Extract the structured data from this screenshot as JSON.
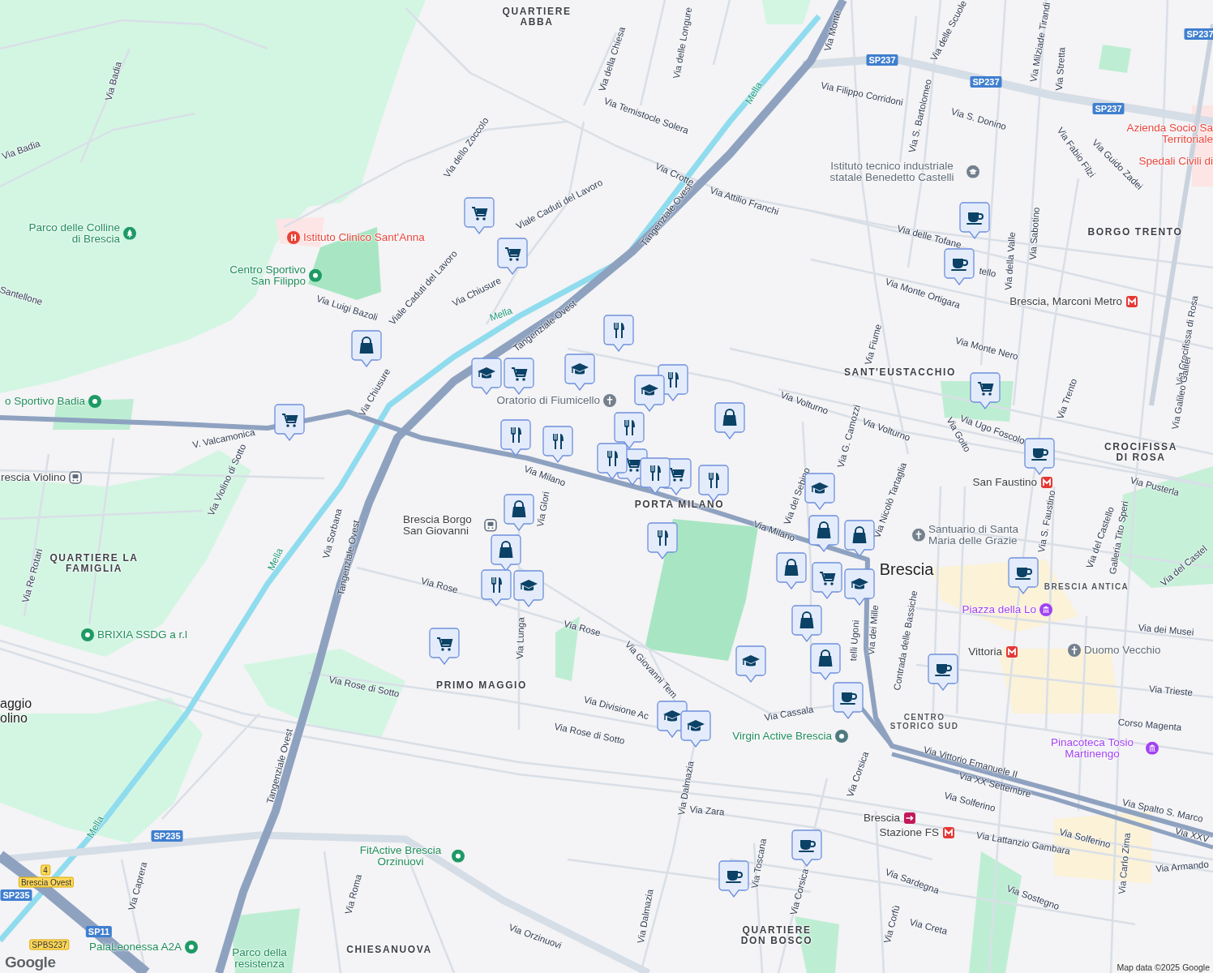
{
  "map": {
    "roads": [
      {
        "text": "Via Badia",
        "kind": "street"
      },
      {
        "text": "Via Badia",
        "kind": "street"
      },
      {
        "text": "Santellone",
        "kind": "street"
      },
      {
        "text": "Via Luigi Bazoli",
        "kind": "street"
      },
      {
        "text": "Viale Caduti del Lavoro",
        "kind": "street"
      },
      {
        "text": "Viale Caduti del Lavoro",
        "kind": "street"
      },
      {
        "text": "Via Chiusure",
        "kind": "street"
      },
      {
        "text": "Via Chiusure",
        "kind": "street"
      },
      {
        "text": "Via dello Zoccolo",
        "kind": "street"
      },
      {
        "text": "Via della Chiesa",
        "kind": "street"
      },
      {
        "text": "Via delle Longure",
        "kind": "street"
      },
      {
        "text": "Via Temistocle Solera",
        "kind": "street"
      },
      {
        "text": "Via Crotte",
        "kind": "street"
      },
      {
        "text": "Via Attilio Franchi",
        "kind": "street"
      },
      {
        "text": "Via Filippo Corridoni",
        "kind": "street"
      },
      {
        "text": "Via S. Bartolomeo",
        "kind": "street"
      },
      {
        "text": "Via delle Scuole",
        "kind": "street"
      },
      {
        "text": "Via Milziade Tirandi",
        "kind": "street"
      },
      {
        "text": "Via Stretta",
        "kind": "street"
      },
      {
        "text": "Via S. Donino",
        "kind": "street"
      },
      {
        "text": "Via Fabio Filzi",
        "kind": "street"
      },
      {
        "text": "Via Guido Zadei",
        "kind": "street"
      },
      {
        "text": "Via delle Tofane",
        "kind": "street"
      },
      {
        "text": "tello",
        "kind": "street"
      },
      {
        "text": "Via Monte Ortigara",
        "kind": "street"
      },
      {
        "text": "Via della Valle",
        "kind": "street"
      },
      {
        "text": "Via Sabotino",
        "kind": "street"
      },
      {
        "text": "Via Monte Nero",
        "kind": "street"
      },
      {
        "text": "Via Fiume",
        "kind": "street"
      },
      {
        "text": "Via Volturno",
        "kind": "street"
      },
      {
        "text": "Via Volturno",
        "kind": "street"
      },
      {
        "text": "Via Ugo Foscolo",
        "kind": "street"
      },
      {
        "text": "Via Goito",
        "kind": "street"
      },
      {
        "text": "Via Trento",
        "kind": "street"
      },
      {
        "text": "Via Crocifissa di Rosa",
        "kind": "street"
      },
      {
        "text": "Via Galileo Galilei",
        "kind": "street"
      },
      {
        "text": "Via Pusterla",
        "kind": "street"
      },
      {
        "text": "Via Nicolò Tartaglia",
        "kind": "street"
      },
      {
        "text": "Via G. Camozzi",
        "kind": "street"
      },
      {
        "text": "Via del Sebino",
        "kind": "street"
      },
      {
        "text": "Via Milano",
        "kind": "street"
      },
      {
        "text": "Via Milano",
        "kind": "street"
      },
      {
        "text": "Via S. Faustino",
        "kind": "street"
      },
      {
        "text": "Via del Castello",
        "kind": "street"
      },
      {
        "text": "Galleria Tito Speri",
        "kind": "street"
      },
      {
        "text": "Via del Castel",
        "kind": "street"
      },
      {
        "text": "Via dei Musei",
        "kind": "street"
      },
      {
        "text": "Via Trieste",
        "kind": "street"
      },
      {
        "text": "Corso Magenta",
        "kind": "street"
      },
      {
        "text": "Contrada delle Bassiche",
        "kind": "street"
      },
      {
        "text": "Via dei Mille",
        "kind": "street"
      },
      {
        "text": "telli Ugoni",
        "kind": "street"
      },
      {
        "text": "Via Cassala",
        "kind": "street"
      },
      {
        "text": "Via Giovanni Tem",
        "kind": "street"
      },
      {
        "text": "Via Divisione Ac",
        "kind": "street"
      },
      {
        "text": "Via Rose",
        "kind": "street"
      },
      {
        "text": "Via Rose",
        "kind": "street"
      },
      {
        "text": "Via Rose di Sotto",
        "kind": "street"
      },
      {
        "text": "Via Rose di Sotto",
        "kind": "street"
      },
      {
        "text": "Via Lunga",
        "kind": "street"
      },
      {
        "text": "Via Glori",
        "kind": "street"
      },
      {
        "text": "V. Valcamonica",
        "kind": "street"
      },
      {
        "text": "Via Violino di Sotto",
        "kind": "street"
      },
      {
        "text": "Via Sorbana",
        "kind": "street"
      },
      {
        "text": "Tangenziale Ovest",
        "kind": "street"
      },
      {
        "text": "Tangenziale Ovest",
        "kind": "street"
      },
      {
        "text": "Tangenziale Ovest",
        "kind": "street"
      },
      {
        "text": "Tangenziale Ovest",
        "kind": "street"
      },
      {
        "text": "Mella",
        "kind": "river"
      },
      {
        "text": "Mella",
        "kind": "river"
      },
      {
        "text": "Mella",
        "kind": "river"
      },
      {
        "text": "Mella",
        "kind": "river"
      },
      {
        "text": "Via Re Rotari",
        "kind": "street"
      },
      {
        "text": "Via Dalmazia",
        "kind": "street"
      },
      {
        "text": "Via Dalmazia",
        "kind": "street"
      },
      {
        "text": "Via Zara",
        "kind": "street"
      },
      {
        "text": "Via Toscana",
        "kind": "street"
      },
      {
        "text": "Via Corsica",
        "kind": "street"
      },
      {
        "text": "Via Corsica",
        "kind": "street"
      },
      {
        "text": "Via Solferino",
        "kind": "street"
      },
      {
        "text": "Via Solferino",
        "kind": "street"
      },
      {
        "text": "Via Vittorio Emanuele II",
        "kind": "street"
      },
      {
        "text": "Via XX Settembre",
        "kind": "street"
      },
      {
        "text": "Via Spalto S. Marco",
        "kind": "street"
      },
      {
        "text": "Via XXV",
        "kind": "street"
      },
      {
        "text": "Via Lattanzio Gambara",
        "kind": "street"
      },
      {
        "text": "Via Armando",
        "kind": "street"
      },
      {
        "text": "Via Sardegna",
        "kind": "street"
      },
      {
        "text": "Via Sostegno",
        "kind": "street"
      },
      {
        "text": "Via Corfù",
        "kind": "street"
      },
      {
        "text": "Via Creta",
        "kind": "street"
      },
      {
        "text": "Via Carlo Zima",
        "kind": "street"
      },
      {
        "text": "Via Orzinuovi",
        "kind": "street"
      },
      {
        "text": "Via Roma",
        "kind": "street"
      },
      {
        "text": "Via Caprera",
        "kind": "street"
      },
      {
        "text": "Via Monte",
        "kind": "street"
      }
    ],
    "areas": [
      {
        "text": "QUARTIERE ABBA",
        "kind": "district"
      },
      {
        "text": "BORGO TRENTO",
        "kind": "district"
      },
      {
        "text": "CROCIFISSA DI ROSA",
        "kind": "district"
      },
      {
        "text": "QUARTIERE LA FAMIGLIA",
        "kind": "district"
      },
      {
        "text": "PRIMO MAGGIO",
        "kind": "district"
      },
      {
        "text": "PORTA MILANO",
        "kind": "district"
      },
      {
        "text": "BRESCIA ANTICA",
        "kind": "quarter"
      },
      {
        "text": "CENTRO STORICO SUD",
        "kind": "quarter"
      },
      {
        "text": "QUARTIERE DON BOSCO",
        "kind": "district"
      },
      {
        "text": "CHIESANUOVA",
        "kind": "district"
      },
      {
        "text": "SANT'EUSTACCHIO",
        "kind": "district"
      },
      {
        "text": "Brescia",
        "kind": "city"
      },
      {
        "text": "aggio olino",
        "kind": "town"
      }
    ],
    "places": [
      {
        "text": "Azienda Socio Sa Territoriale",
        "kind": "hospital"
      },
      {
        "text": "Spedali Civili di",
        "kind": "hospital"
      },
      {
        "text": "Istituto tecnico industriale statale Benedetto Castelli",
        "kind": "school"
      },
      {
        "text": "Parco delle Colline di Brescia",
        "kind": "park"
      },
      {
        "text": "Istituto Clinico Sant'Anna",
        "kind": "hospital"
      },
      {
        "text": "Centro Sportivo San Filippo",
        "kind": "sport"
      },
      {
        "text": "Brescia, Marconi Metro",
        "kind": "metro"
      },
      {
        "text": "o Sportivo Badia",
        "kind": "sport"
      },
      {
        "text": "Oratorio di Fiumicello",
        "kind": "church"
      },
      {
        "text": "rescia Violino",
        "kind": "bus"
      },
      {
        "text": "San Faustino",
        "kind": "metro"
      },
      {
        "text": "Brescia Borgo San Giovanni",
        "kind": "bus"
      },
      {
        "text": "Santuario di Santa Maria delle Grazie",
        "kind": "church"
      },
      {
        "text": "Piazza della Lo",
        "kind": "landmark"
      },
      {
        "text": "BRIXIA SSDG a r.l",
        "kind": "sport"
      },
      {
        "text": "Vittoria",
        "kind": "metro"
      },
      {
        "text": "Duomo Vecchio",
        "kind": "church"
      },
      {
        "text": "Virgin Active Brescia",
        "kind": "gym"
      },
      {
        "text": "Pinacoteca Tosio Martinengo",
        "kind": "landmark"
      },
      {
        "text": "Brescia",
        "kind": "train"
      },
      {
        "text": "Stazione FS",
        "kind": "metro"
      },
      {
        "text": "FitActive Brescia Orzinuovi",
        "kind": "sport"
      },
      {
        "text": "PalaLeonessa A2A",
        "kind": "sport"
      },
      {
        "text": "Parco della resistenza",
        "kind": "park"
      }
    ],
    "shields": [
      {
        "text": "SP237",
        "kind": "route"
      },
      {
        "text": "SP237",
        "kind": "route"
      },
      {
        "text": "SP237",
        "kind": "route"
      },
      {
        "text": "SP237",
        "kind": "route"
      },
      {
        "text": "SP235",
        "kind": "route"
      },
      {
        "text": "SP235",
        "kind": "route"
      },
      {
        "text": "SP11",
        "kind": "route"
      },
      {
        "text": "SPBS237",
        "kind": "exit"
      },
      {
        "text": "4",
        "kind": "exit"
      },
      {
        "text": "Brescia Ovest",
        "kind": "exit"
      }
    ],
    "pins": [
      {
        "kind": "grocery"
      },
      {
        "kind": "grocery"
      },
      {
        "kind": "grocery"
      },
      {
        "kind": "grocery"
      },
      {
        "kind": "grocery"
      },
      {
        "kind": "grocery"
      },
      {
        "kind": "grocery"
      },
      {
        "kind": "grocery"
      },
      {
        "kind": "grocery"
      },
      {
        "kind": "shopping"
      },
      {
        "kind": "shopping"
      },
      {
        "kind": "shopping"
      },
      {
        "kind": "shopping"
      },
      {
        "kind": "shopping"
      },
      {
        "kind": "shopping"
      },
      {
        "kind": "shopping"
      },
      {
        "kind": "shopping"
      },
      {
        "kind": "shopping"
      },
      {
        "kind": "restaurant"
      },
      {
        "kind": "restaurant"
      },
      {
        "kind": "restaurant"
      },
      {
        "kind": "restaurant"
      },
      {
        "kind": "restaurant"
      },
      {
        "kind": "restaurant"
      },
      {
        "kind": "restaurant"
      },
      {
        "kind": "restaurant"
      },
      {
        "kind": "restaurant"
      },
      {
        "kind": "restaurant"
      },
      {
        "kind": "school"
      },
      {
        "kind": "school"
      },
      {
        "kind": "school"
      },
      {
        "kind": "school"
      },
      {
        "kind": "school"
      },
      {
        "kind": "school"
      },
      {
        "kind": "school"
      },
      {
        "kind": "school"
      },
      {
        "kind": "school"
      },
      {
        "kind": "cafe"
      },
      {
        "kind": "cafe"
      },
      {
        "kind": "cafe"
      },
      {
        "kind": "cafe"
      },
      {
        "kind": "cafe"
      },
      {
        "kind": "cafe"
      },
      {
        "kind": "cafe"
      },
      {
        "kind": "cafe"
      }
    ]
  },
  "attribution": "Map data ©2025 Google",
  "logo": "Google"
}
